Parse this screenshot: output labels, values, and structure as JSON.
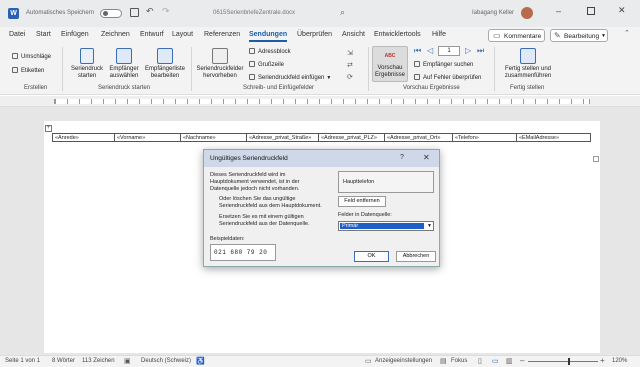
{
  "titlebar": {
    "autosave_label": "Automatisches Speichern",
    "doc_title": "0615SerienbriefeZentrale.docx",
    "user": "Iabagang Keller",
    "colors": {
      "bg": "#e9ebed",
      "accent": "#1a5ea8"
    }
  },
  "menu": {
    "tabs": [
      "Datei",
      "Start",
      "Einfügen",
      "Zeichnen",
      "Entwurf",
      "Layout",
      "Referenzen",
      "Sendungen",
      "Überprüfen",
      "Ansicht",
      "Entwicklertools",
      "Hilfe"
    ],
    "active": "Sendungen",
    "comments_label": "Kommentare",
    "edit_label": "Bearbeitung"
  },
  "ribbon": {
    "erstellen": {
      "envelopes": "Umschläge",
      "labels": "Etiketten",
      "group": "Erstellen"
    },
    "seriendruck_starten": {
      "start": "Seriendruck starten",
      "recipients": "Empfänger auswählen",
      "edit_list": "Empfängerliste bearbeiten",
      "group": "Seriendruck starten"
    },
    "felder": {
      "highlight": "Seriendruckfelder hervorheben",
      "address": "Adressblock",
      "greeting": "Grußzeile",
      "insert": "Seriendruckfeld einfügen",
      "group": "Schreib- und Einfügefelder"
    },
    "vorschau": {
      "preview": "Vorschau Ergebnisse",
      "record": "1",
      "find": "Empfänger suchen",
      "check": "Auf Fehler überprüfen",
      "group": "Vorschau Ergebnisse"
    },
    "fertig": {
      "finish": "Fertig stellen und zusammenführen",
      "group": "Fertig stellen"
    }
  },
  "merge_fields": [
    "«Anrede»",
    "«Vorname»",
    "«Nachname»",
    "«Adresse_privat_Straße»",
    "«Adresse_privat_PLZ»",
    "«Adresse_privat_Ort»",
    "«Telefon»",
    "«EMailAdresse»"
  ],
  "dialog": {
    "title": "Ungültiges Seriendruckfeld",
    "help": "?",
    "close": "✕",
    "message": "Dieses Seriendruckfeld wird im Hauptdokument verwendet, ist in der Datenquelle jedoch nicht vorhanden.",
    "field_name": "Haupttelefon",
    "remove_text": "Oder löschen Sie das ungültige Seriendruckfeld aus dem Hauptdokument.",
    "remove_button": "Feld entfernen",
    "replace_text": "Ersetzen Sie es mit einem gültigen Seriendruckfeld aus der Datenquelle.",
    "fields_label": "Felder in Datenquelle:",
    "selected_field": "Primär",
    "sample_label": "Beispieldaten:",
    "sample_value": "021 680 79 20",
    "ok": "OK",
    "cancel": "Abbrechen"
  },
  "status": {
    "page": "Seite 1 von 1",
    "words": "8 Wörter",
    "chars": "113 Zeichen",
    "language": "Deutsch (Schweiz)",
    "display": "Anzeigeeinstellungen",
    "focus": "Fokus",
    "zoom": "120%"
  }
}
